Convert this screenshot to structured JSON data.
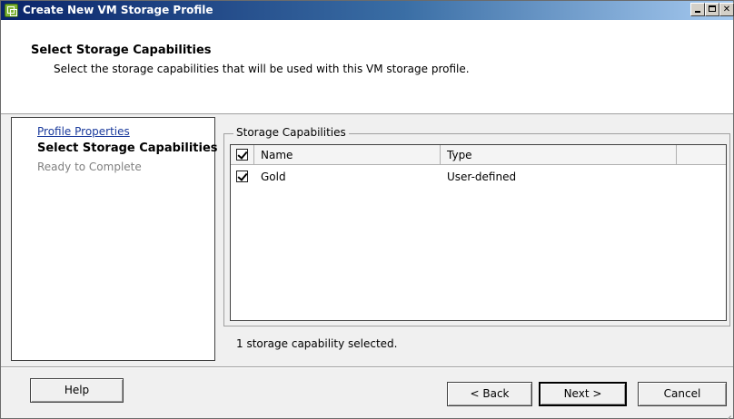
{
  "window": {
    "title": "Create New VM Storage Profile",
    "icon": "vm-storage-profile-icon",
    "controls": [
      "minimize-icon",
      "maximize-icon",
      "close-icon"
    ]
  },
  "header": {
    "title": "Select Storage Capabilities",
    "subtitle": "Select the storage capabilities that will be used with this VM storage profile."
  },
  "nav": {
    "items": [
      {
        "label": "Profile Properties",
        "state": "link"
      },
      {
        "label": "Select Storage Capabilities",
        "state": "current"
      },
      {
        "label": "Ready to Complete",
        "state": "disabled"
      }
    ]
  },
  "capabilities": {
    "group_label": "Storage Capabilities",
    "columns": [
      "Name",
      "Type"
    ],
    "header_checked": true,
    "rows": [
      {
        "checked": true,
        "name": "Gold",
        "type": "User-defined"
      }
    ],
    "status": "1 storage capability selected."
  },
  "buttons": {
    "help": "Help",
    "back": "< Back",
    "next": "Next >",
    "cancel": "Cancel"
  },
  "colors": {
    "titlebar_start": "#0a246a",
    "titlebar_end": "#a6caf0",
    "link": "#1a3a9c",
    "disabled": "#808080"
  }
}
